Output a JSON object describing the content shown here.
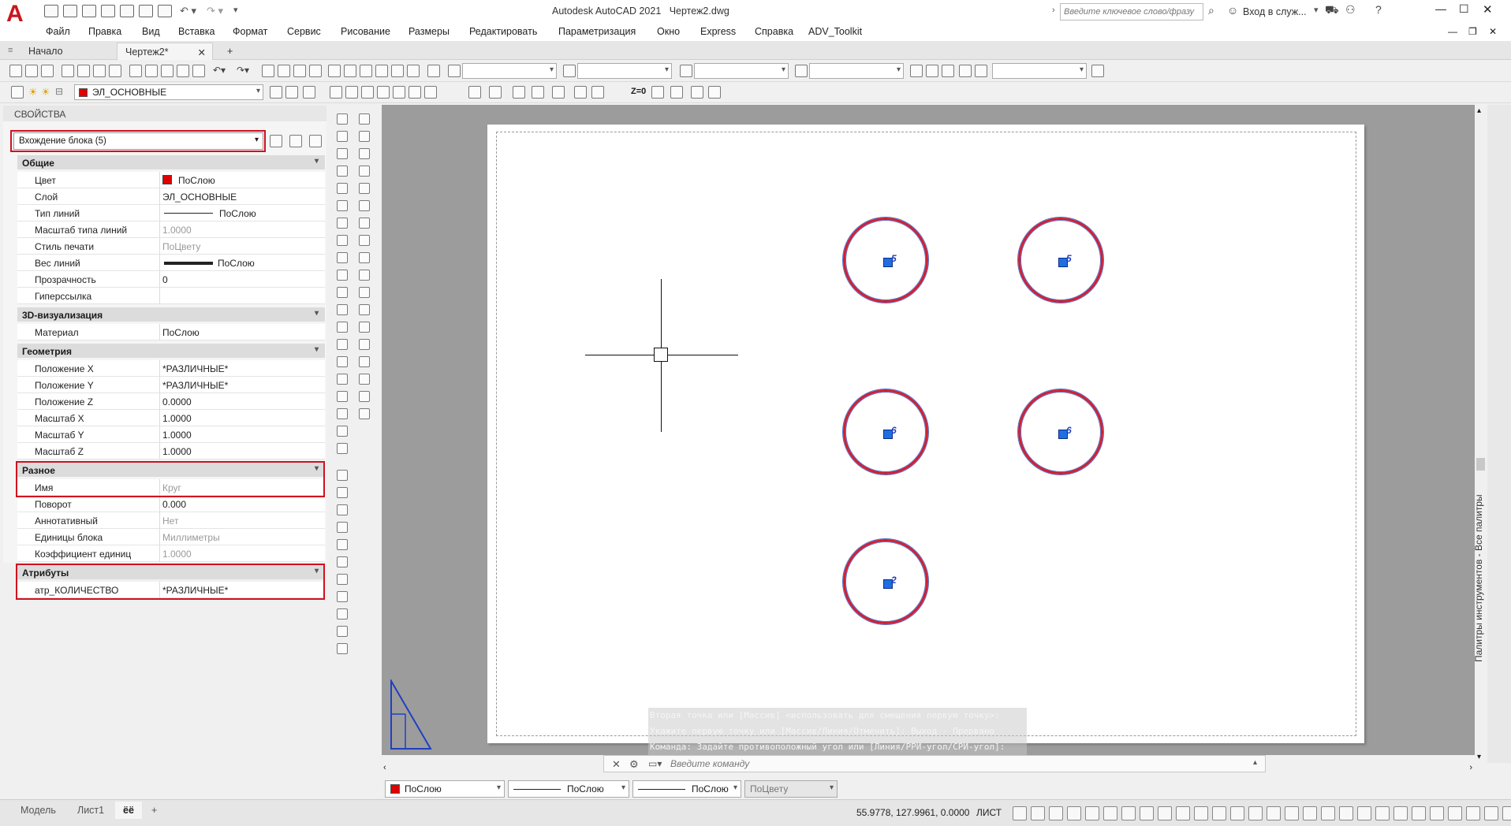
{
  "app": {
    "title": "Autodesk AutoCAD 2021",
    "file": "Чертеж2.dwg",
    "logo": "A"
  },
  "search": {
    "placeholder": "Введите ключевое слово/фразу"
  },
  "signin": "Вход в служ...",
  "menu": [
    "Файл",
    "Правка",
    "Вид",
    "Вставка",
    "Формат",
    "Сервис",
    "Рисование",
    "Размеры",
    "Редактировать",
    "Параметризация",
    "Окно",
    "Express",
    "Справка",
    "ADV_Toolkit"
  ],
  "tabs": {
    "start": "Начало",
    "drawing": "Чертеж2*",
    "add": "+"
  },
  "layer": {
    "name": "ЭЛ_ОСНОВНЫЕ",
    "color": "#e00000"
  },
  "properties": {
    "header": "СВОЙСТВА",
    "selection": "Вхождение блока (5)",
    "sections": {
      "general": "Общие",
      "viz3d": "3D-визуализация",
      "geometry": "Геометрия",
      "misc": "Разное",
      "attributes": "Атрибуты"
    },
    "general": [
      {
        "k": "Цвет",
        "v": "ПоСлою"
      },
      {
        "k": "Слой",
        "v": "ЭЛ_ОСНОВНЫЕ"
      },
      {
        "k": "Тип линий",
        "v": "ПоСлою"
      },
      {
        "k": "Масштаб типа линий",
        "v": "1.0000"
      },
      {
        "k": "Стиль печати",
        "v": "ПоЦвету"
      },
      {
        "k": "Вес линий",
        "v": "ПоСлою"
      },
      {
        "k": "Прозрачность",
        "v": "0"
      },
      {
        "k": "Гиперссылка",
        "v": ""
      }
    ],
    "viz3d": [
      {
        "k": "Материал",
        "v": "ПоСлою"
      }
    ],
    "geometry": [
      {
        "k": "Положение X",
        "v": "*РАЗЛИЧНЫЕ*"
      },
      {
        "k": "Положение Y",
        "v": "*РАЗЛИЧНЫЕ*"
      },
      {
        "k": "Положение Z",
        "v": "0.0000"
      },
      {
        "k": "Масштаб X",
        "v": "1.0000"
      },
      {
        "k": "Масштаб Y",
        "v": "1.0000"
      },
      {
        "k": "Масштаб Z",
        "v": "1.0000"
      }
    ],
    "misc": [
      {
        "k": "Имя",
        "v": "Круг"
      },
      {
        "k": "Поворот",
        "v": "0.000"
      },
      {
        "k": "Аннотативный",
        "v": "Нет"
      },
      {
        "k": "Единицы блока",
        "v": "Миллиметры"
      },
      {
        "k": "Коэффициент единиц",
        "v": "1.0000"
      }
    ],
    "attributes": [
      {
        "k": "атр_КОЛИЧЕСТВО",
        "v": "*РАЗЛИЧНЫЕ*"
      }
    ]
  },
  "blocks": [
    {
      "label": "5"
    },
    {
      "label": "5"
    },
    {
      "label": "6"
    },
    {
      "label": "6"
    },
    {
      "label": "2"
    }
  ],
  "command": {
    "history": [
      "Вторая точка или [Массив] <использовать для смещения первую точку>:",
      "Укажите первую точку или [Массив/Линия/Отменить]: Выход - Прервано",
      "Команда: Задайте противоположный угол или [Линия/РРИ-угол/СРИ-угол]:"
    ],
    "placeholder": "Введите команду"
  },
  "propbar": {
    "color": "ПоСлою",
    "linetype": "ПоСлою",
    "lineweight": "ПоСлою",
    "plotstyle": "ПоЦвету"
  },
  "layout_tabs": [
    "Модель",
    "Лист1",
    "ёё"
  ],
  "status": {
    "coords": "55.9778, 127.9961, 0.0000",
    "space": "ЛИСТ"
  },
  "palette_label": "Палитры инструментов - Все палитры",
  "colors": {
    "accent_red": "#d01020",
    "block_blue": "#1f6fe0"
  }
}
